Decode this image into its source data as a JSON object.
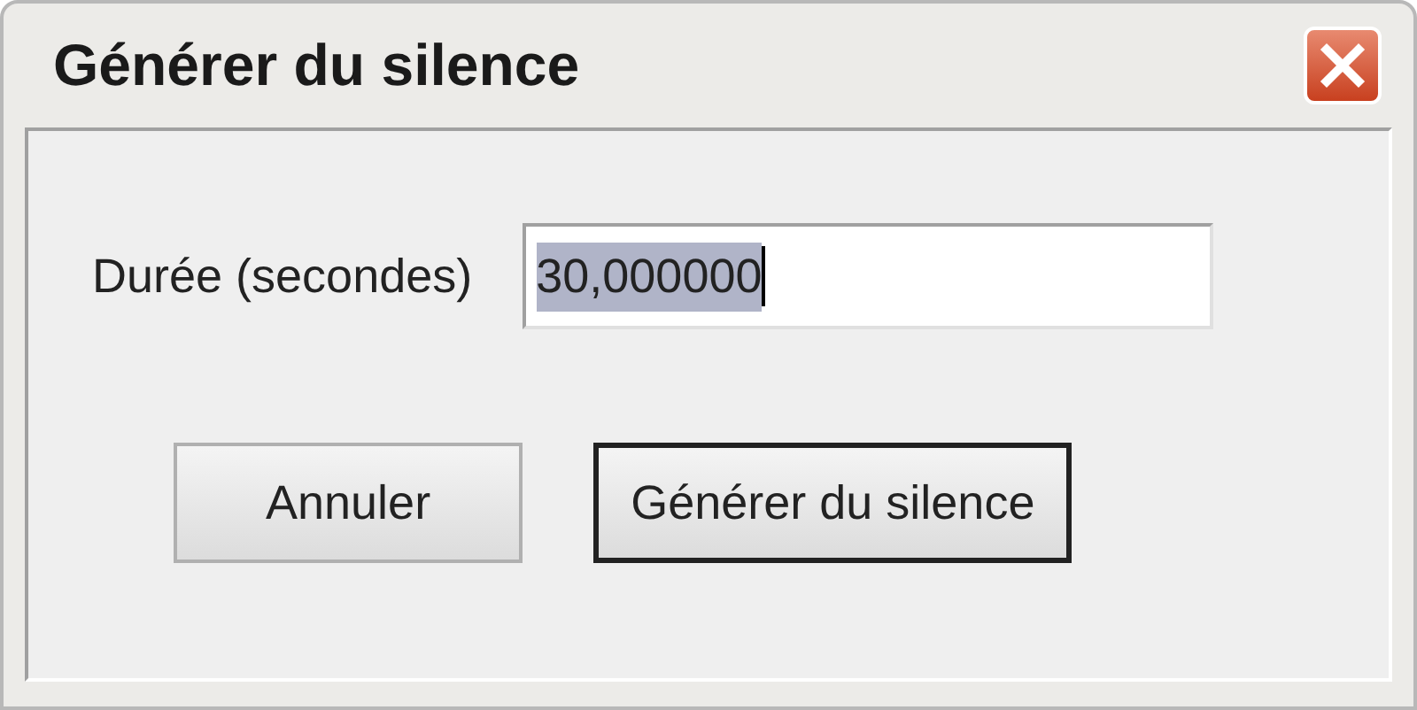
{
  "window": {
    "title": "Générer du silence"
  },
  "field": {
    "label": "Durée (secondes)",
    "value": "30,000000",
    "text_selected": true
  },
  "buttons": [
    {
      "label": "Annuler",
      "default": false
    },
    {
      "label": "Générer du silence",
      "default": true
    }
  ]
}
